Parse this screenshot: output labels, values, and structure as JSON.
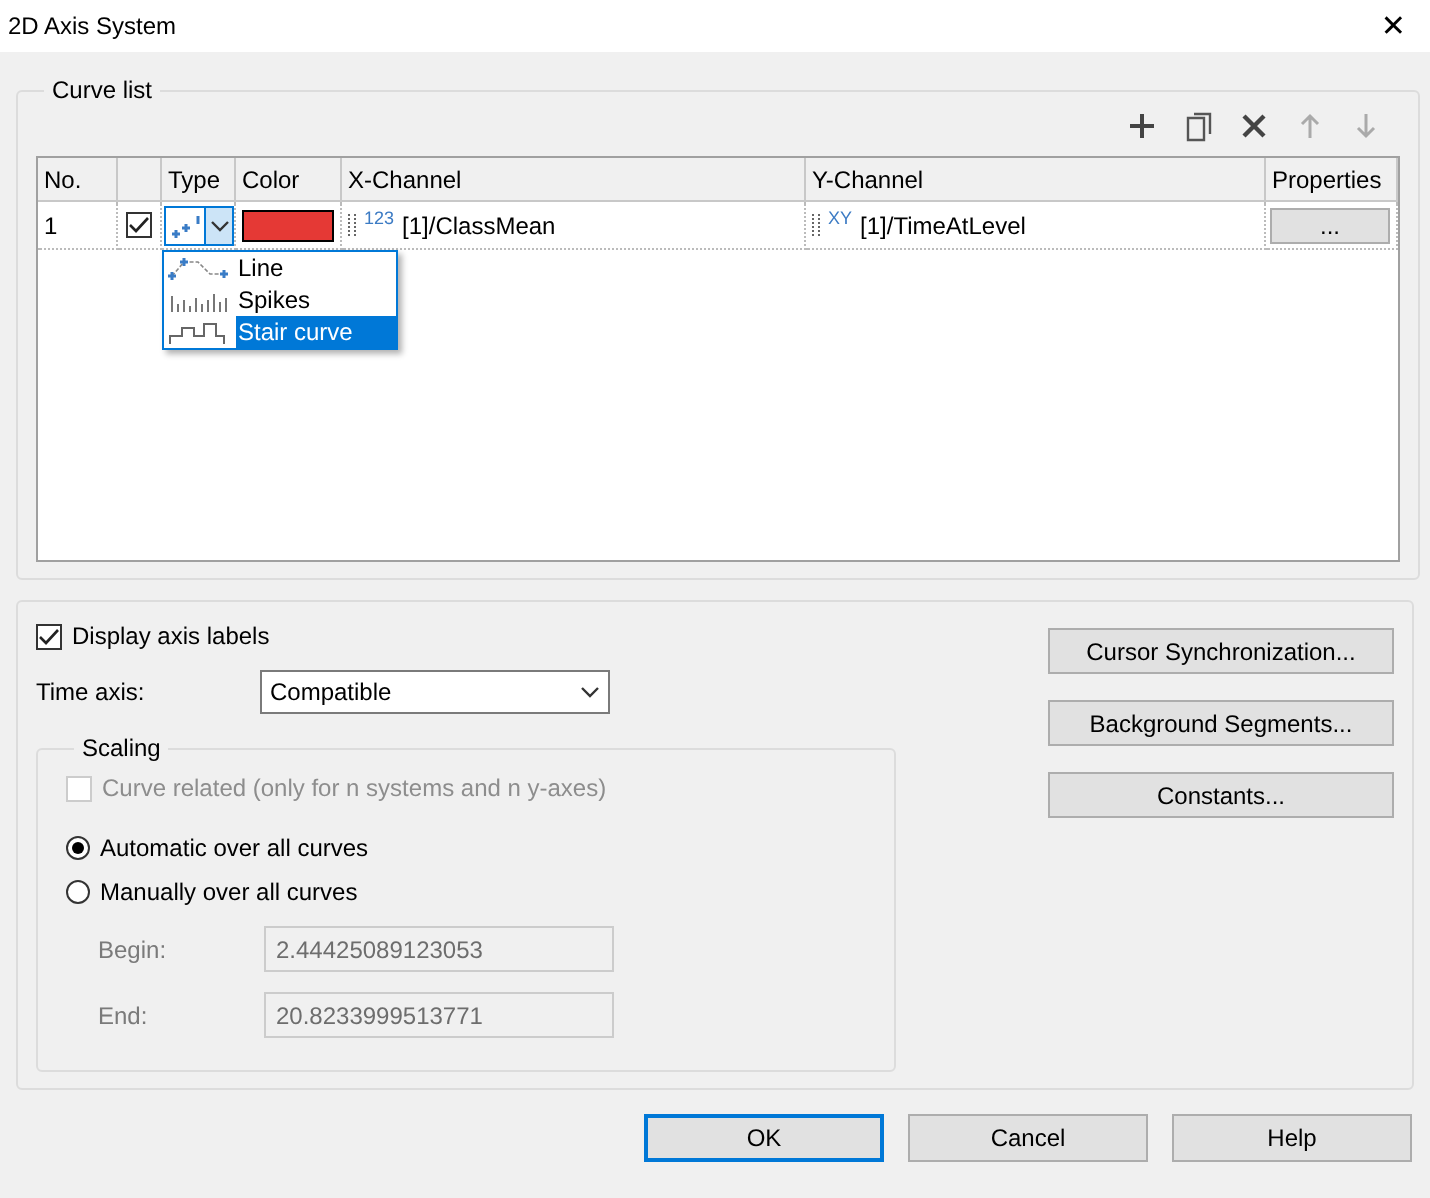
{
  "window": {
    "title": "2D Axis System",
    "close": "✕"
  },
  "curve_list": {
    "title": "Curve list",
    "toolbar": [
      {
        "kind": "add"
      },
      {
        "kind": "copy"
      },
      {
        "kind": "delete"
      },
      {
        "kind": "up"
      },
      {
        "kind": "down"
      }
    ],
    "columns": [
      "No.",
      "",
      "Type",
      "Color",
      "X-Channel",
      "Y-Channel",
      "Properties"
    ],
    "rows": [
      {
        "no": "1",
        "checked": true,
        "color": "#e53935",
        "x_tag": "123",
        "x_channel": "[1]/ClassMean",
        "y_tag": "XY",
        "y_channel": "[1]/TimeAtLevel",
        "properties": "..."
      }
    ],
    "type_dropdown": {
      "expanded": true,
      "options": [
        {
          "kind": "line",
          "label": "Line",
          "selected": false
        },
        {
          "kind": "spikes",
          "label": "Spikes",
          "selected": false
        },
        {
          "kind": "stair",
          "label": "Stair curve",
          "selected": true
        }
      ]
    }
  },
  "display_axis_labels": {
    "label": "Display axis labels",
    "checked": true
  },
  "time_axis": {
    "label": "Time axis:",
    "value": "Compatible"
  },
  "scaling": {
    "title": "Scaling",
    "curve_related": {
      "label": "Curve related (only for n systems and n y-axes)",
      "checked": false,
      "disabled": true
    },
    "modes": [
      {
        "label": "Automatic over all curves",
        "selected": true
      },
      {
        "label": "Manually over all curves",
        "selected": false
      }
    ],
    "fields": [
      {
        "label": "Begin:",
        "value": "2.44425089123053",
        "disabled": true
      },
      {
        "label": "End:",
        "value": "20.8233999513771",
        "disabled": true
      }
    ]
  },
  "side_buttons": [
    "Cursor Synchronization...",
    "Background Segments...",
    "Constants..."
  ],
  "buttons": [
    {
      "label": "OK",
      "default": true
    },
    {
      "label": "Cancel",
      "default": false
    },
    {
      "label": "Help",
      "default": false
    }
  ]
}
